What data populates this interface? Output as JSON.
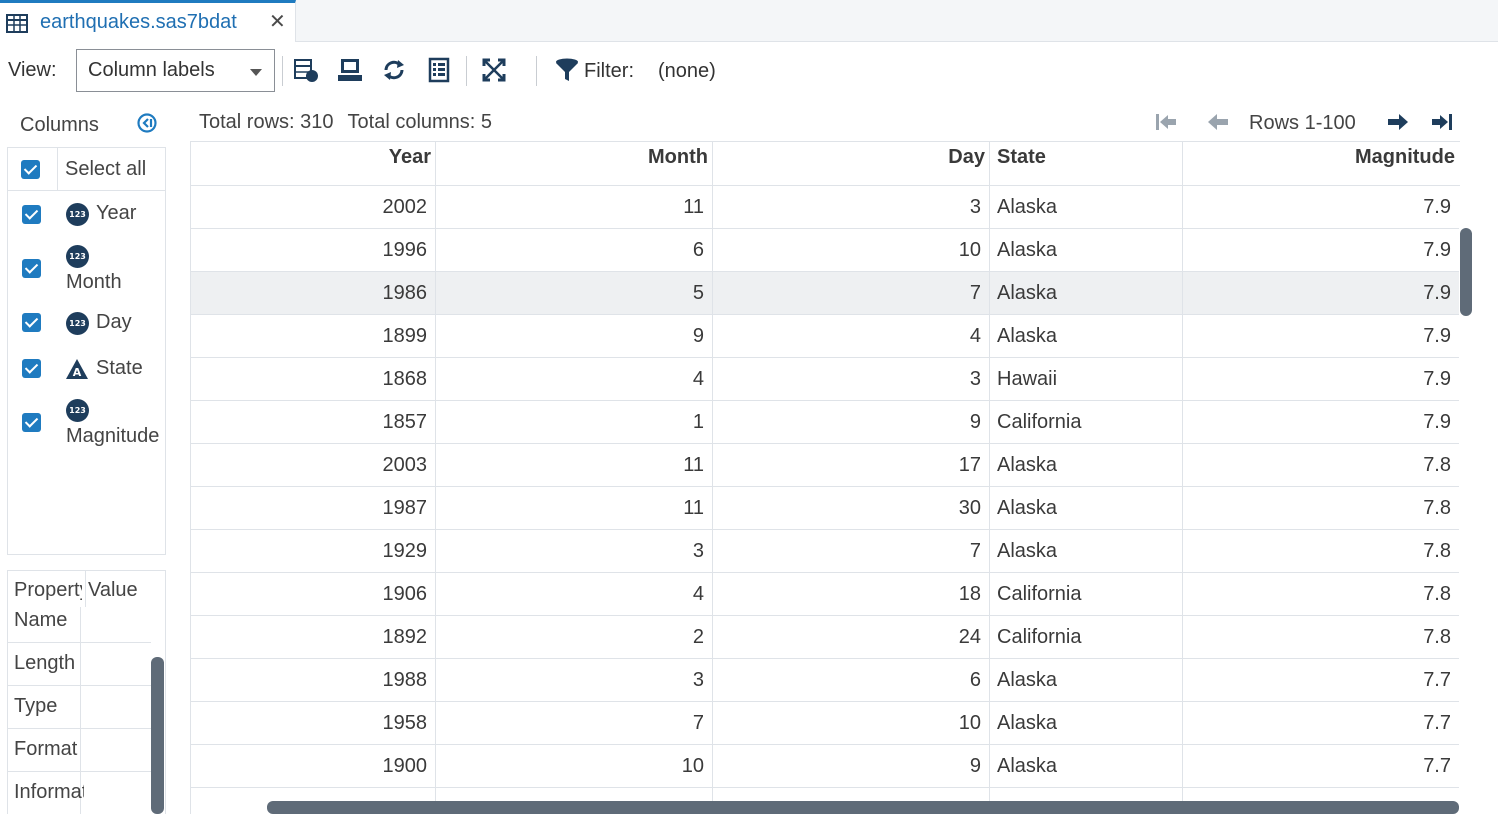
{
  "tab": {
    "title": "earthquakes.sas7bdat",
    "close": "✕"
  },
  "toolbar": {
    "view_label": "View:",
    "view_selected": "Column labels",
    "filter_label": "Filter:",
    "filter_value": "(none)"
  },
  "columns_panel": {
    "title": "Columns",
    "select_all": "Select all",
    "items": [
      {
        "name": "Year",
        "type_icon": "numeric-icon",
        "checked": true
      },
      {
        "name": "Month",
        "type_icon": "numeric-icon",
        "checked": true
      },
      {
        "name": "Day",
        "type_icon": "numeric-icon",
        "checked": true
      },
      {
        "name": "State",
        "type_icon": "character-icon",
        "checked": true
      },
      {
        "name": "Magnitude",
        "type_icon": "numeric-icon",
        "checked": true
      }
    ],
    "numeric_badge": "123"
  },
  "properties_panel": {
    "header_property": "Property",
    "header_value": "Value",
    "rows": [
      "Name",
      "Length",
      "Type",
      "Format",
      "Informat"
    ]
  },
  "summary": {
    "total_rows": "Total rows: 310",
    "total_columns": "Total columns: 5"
  },
  "pager": {
    "label": "Rows 1-100"
  },
  "grid": {
    "headers": [
      "Year",
      "Month",
      "Day",
      "State",
      "Magnitude"
    ],
    "rows": [
      [
        "2002",
        "11",
        "3",
        "Alaska",
        "7.9"
      ],
      [
        "1996",
        "6",
        "10",
        "Alaska",
        "7.9"
      ],
      [
        "1986",
        "5",
        "7",
        "Alaska",
        "7.9"
      ],
      [
        "1899",
        "9",
        "4",
        "Alaska",
        "7.9"
      ],
      [
        "1868",
        "4",
        "3",
        "Hawaii",
        "7.9"
      ],
      [
        "1857",
        "1",
        "9",
        "California",
        "7.9"
      ],
      [
        "2003",
        "11",
        "17",
        "Alaska",
        "7.8"
      ],
      [
        "1987",
        "11",
        "30",
        "Alaska",
        "7.8"
      ],
      [
        "1929",
        "3",
        "7",
        "Alaska",
        "7.8"
      ],
      [
        "1906",
        "4",
        "18",
        "California",
        "7.8"
      ],
      [
        "1892",
        "2",
        "24",
        "California",
        "7.8"
      ],
      [
        "1988",
        "3",
        "6",
        "Alaska",
        "7.7"
      ],
      [
        "1958",
        "7",
        "10",
        "Alaska",
        "7.7"
      ],
      [
        "1900",
        "10",
        "9",
        "Alaska",
        "7.7"
      ]
    ],
    "highlighted_row": 2
  },
  "colors": {
    "accent": "#1f7bc0",
    "badge": "#1e3d5c",
    "scrollbar": "#5f6b78",
    "highlight": "#eef0f2"
  }
}
